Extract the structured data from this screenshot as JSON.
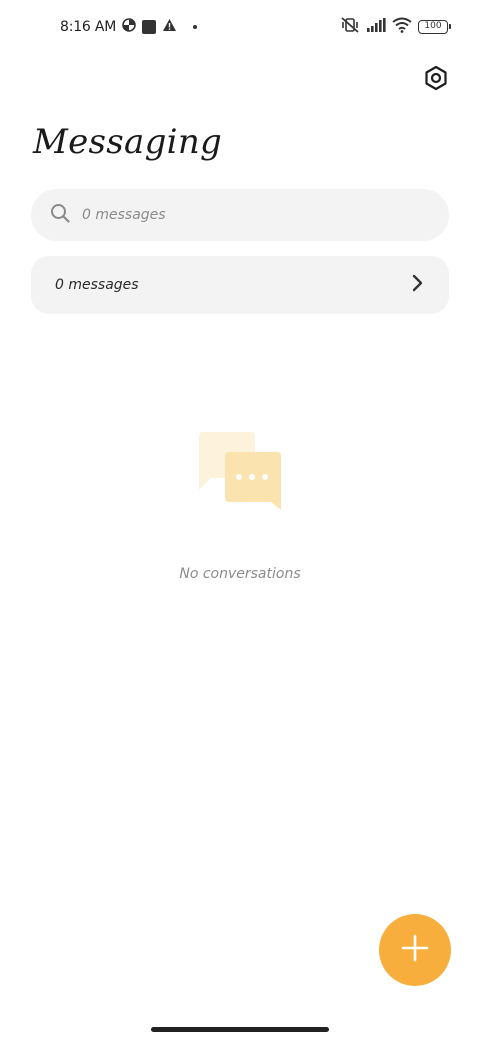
{
  "status_bar": {
    "time": "8:16 AM",
    "battery": "100",
    "icons": [
      "data-saver-icon",
      "square-icon",
      "alert-icon",
      "dot-icon",
      "vibrate-off-icon",
      "signal-icon",
      "wifi-icon",
      "battery-icon"
    ]
  },
  "header": {
    "title": "Messaging",
    "settings_icon": "settings-icon"
  },
  "search": {
    "placeholder": "0 messages",
    "icon": "search-icon"
  },
  "message_row": {
    "label": "0 messages",
    "icon": "chevron-right-icon"
  },
  "empty_state": {
    "icon": "chat-bubbles-icon",
    "text": "No conversations"
  },
  "fab": {
    "icon": "plus-icon"
  },
  "colors": {
    "accent": "#f7ae3d",
    "surface": "#f3f3f3",
    "empty_icon_back": "#fdf3dc",
    "empty_icon_front": "#fbe3b0"
  }
}
